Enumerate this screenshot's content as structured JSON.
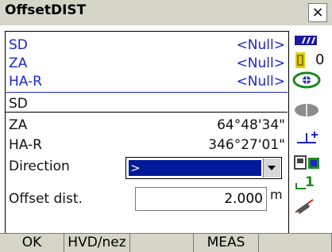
{
  "window": {
    "title": "OffsetDIST",
    "close_glyph": "×"
  },
  "measurements": {
    "sd_label": "SD",
    "sd_value": "<Null>",
    "za_label": "ZA",
    "za_value": "<Null>",
    "har_label": "HA-R",
    "har_value": "<Null>"
  },
  "computed": {
    "sd_label": "SD",
    "sd_value": "",
    "za_label": "ZA",
    "za_value": "64°48'34\"",
    "har_label": "HA-R",
    "har_value": "346°27'01\""
  },
  "direction": {
    "label": "Direction",
    "selected": ">"
  },
  "offset": {
    "label": "Offset dist.",
    "value": "2.000",
    "unit": "m"
  },
  "status": {
    "battery_icon": "battery-icon",
    "prism_constant": "0",
    "prism_icon": "prism-icon",
    "tilt_icon": "tilt-icon",
    "laser_icon": "laser-icon",
    "target_icon": "target-height-icon",
    "memory_icon": "memory-card-icon",
    "input_mode": "1",
    "input_mode_icon": "input-mode-icon",
    "pen_icon": "pen-icon"
  },
  "softkeys": [
    {
      "label": "OK"
    },
    {
      "label": "HVD/nez"
    },
    {
      "label": ""
    },
    {
      "label": "MEAS"
    },
    {
      "label": ""
    }
  ]
}
